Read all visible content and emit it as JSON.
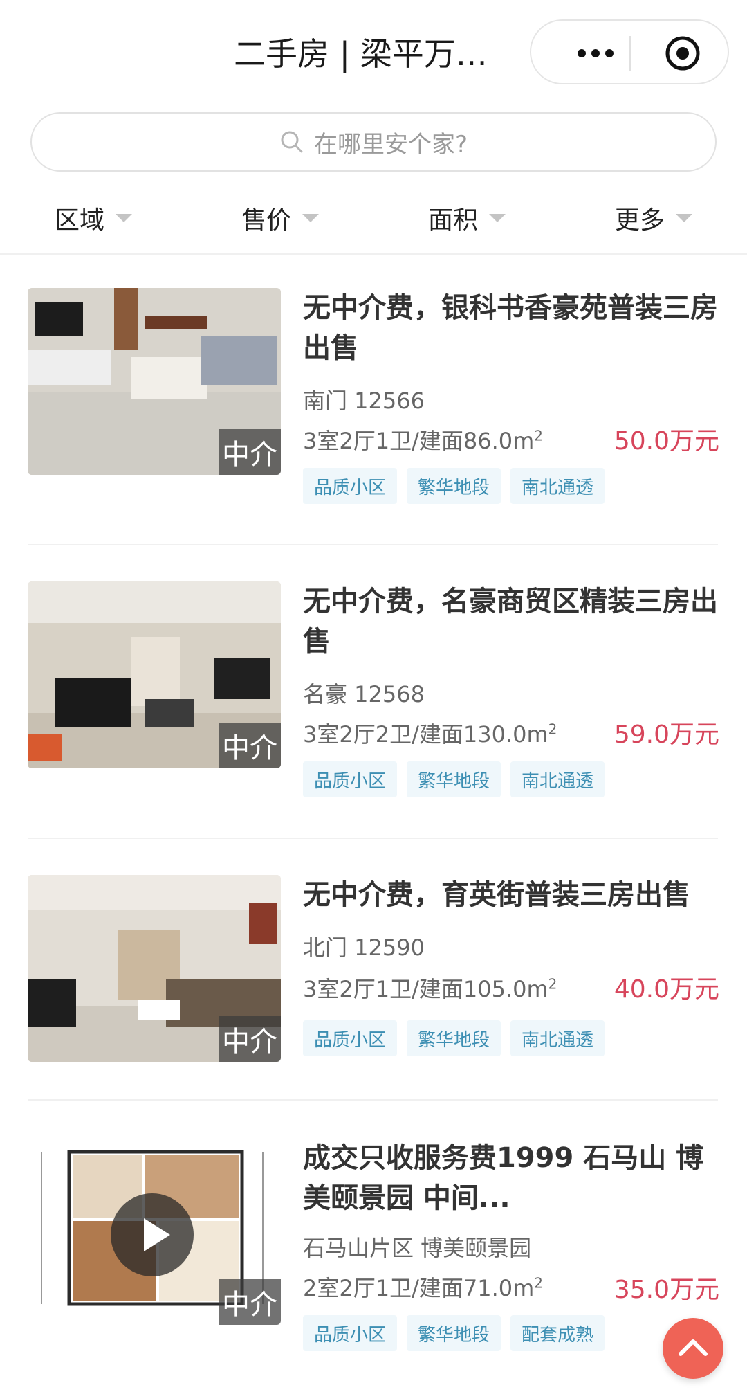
{
  "header": {
    "title": "二手房 | 梁平万…",
    "more_icon": "more-dots-icon",
    "close_icon": "target-icon"
  },
  "search": {
    "placeholder": "在哪里安个家?",
    "icon": "search-icon"
  },
  "filters": [
    {
      "label": "区域"
    },
    {
      "label": "售价"
    },
    {
      "label": "面积"
    },
    {
      "label": "更多"
    }
  ],
  "listings": [
    {
      "title": "无中介费，银科书香豪苑普装三房出售",
      "location": "南门 12566",
      "spec": "3室2厅1卫/建面86.0m",
      "price": "50.0万元",
      "badge": "中介",
      "tags": [
        "品质小区",
        "繁华地段",
        "南北通透"
      ]
    },
    {
      "title": "无中介费，名豪商贸区精装三房出售",
      "location": "名豪 12568",
      "spec": "3室2厅2卫/建面130.0m",
      "price": "59.0万元",
      "badge": "中介",
      "tags": [
        "品质小区",
        "繁华地段",
        "南北通透"
      ]
    },
    {
      "title": "无中介费，育英街普装三房出售",
      "location": "北门 12590",
      "spec": "3室2厅1卫/建面105.0m",
      "price": "40.0万元",
      "badge": "中介",
      "tags": [
        "品质小区",
        "繁华地段",
        "南北通透"
      ]
    },
    {
      "title": "成交只收服务费1999 石马山 博美颐景园 中间...",
      "location": "石马山片区 博美颐景园",
      "spec": "2室2厅1卫/建面71.0m",
      "price": "35.0万元",
      "badge": "中介",
      "tags": [
        "品质小区",
        "繁华地段",
        "配套成熟"
      ]
    }
  ],
  "area_unit_exp": "2",
  "colors": {
    "price": "#d7455b",
    "tag_text": "#3d8fb3",
    "tag_bg": "#eff7fb",
    "fab": "#ef6356"
  }
}
